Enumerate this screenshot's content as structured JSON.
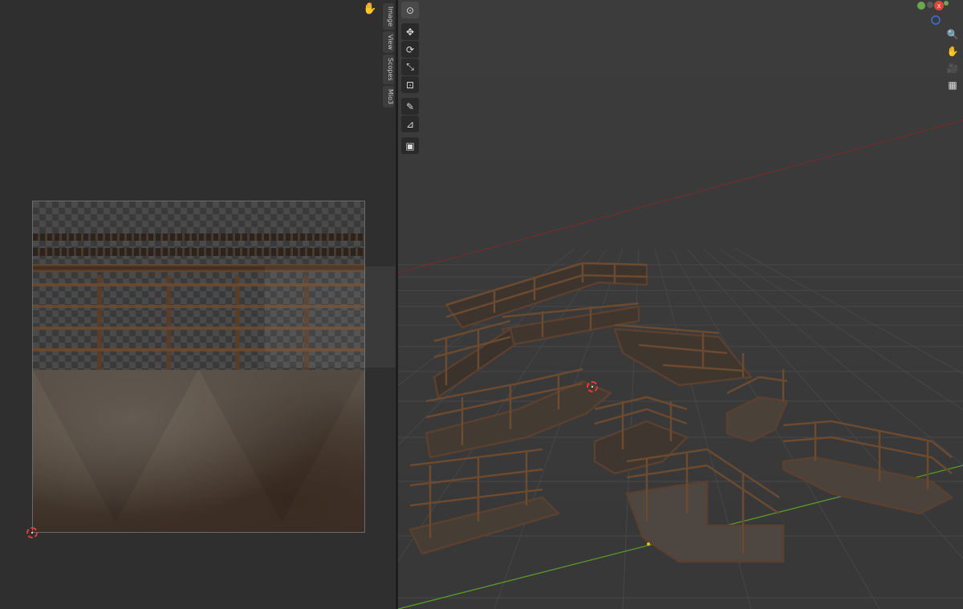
{
  "uv_editor": {
    "sidebar_tabs": [
      "Image",
      "View",
      "Scopes",
      "Mio3"
    ],
    "icons": {
      "hand": "hand-pan-icon",
      "cursor": "3d-cursor-icon"
    }
  },
  "viewport": {
    "toolbar": [
      {
        "name": "cursor-tool",
        "icon": "target-icon"
      },
      {
        "name": "move-tool",
        "icon": "move-arrows-icon"
      },
      {
        "name": "rotate-tool",
        "icon": "rotate-icon"
      },
      {
        "name": "scale-tool",
        "icon": "scale-icon"
      },
      {
        "name": "transform-tool",
        "icon": "transform-icon"
      },
      {
        "name": "annotate-tool",
        "icon": "pencil-icon"
      },
      {
        "name": "measure-tool",
        "icon": "ruler-icon"
      },
      {
        "name": "add-cube-tool",
        "icon": "add-cube-icon"
      }
    ],
    "gizmo": {
      "x_label": "X",
      "colors": {
        "x": "#e0453a",
        "y": "#6aa84f",
        "z": "#3d6fd6"
      }
    },
    "nav_buttons": [
      {
        "name": "zoom-button",
        "icon": "zoom-icon"
      },
      {
        "name": "pan-button",
        "icon": "hand-icon"
      },
      {
        "name": "camera-view-button",
        "icon": "camera-icon"
      },
      {
        "name": "ortho-toggle-button",
        "icon": "grid-icon"
      }
    ],
    "colors": {
      "rust": "#6b4a30",
      "metal": "#4e453c",
      "grid": "#484848",
      "axis_x": "#8a2d2d",
      "axis_y": "#5a9a2a"
    }
  }
}
